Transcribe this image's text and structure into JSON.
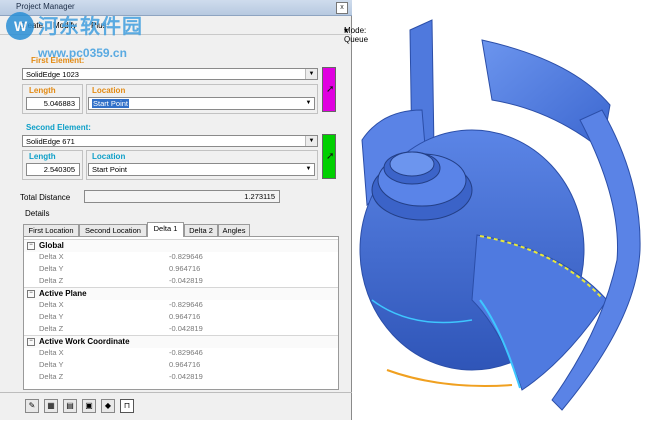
{
  "window": {
    "title": "Project Manager",
    "close_glyph": "x"
  },
  "menu": {
    "items": [
      "Create",
      "Modify",
      "Plus"
    ],
    "mode_label": "Mode: Queue",
    "mode_arrow": "▾"
  },
  "first_element": {
    "label": "First Element:",
    "entity": "SolidEdge 1023",
    "length_label": "Length",
    "length_value": "5.046883",
    "location_label": "Location",
    "location_value": "Start Point",
    "picker_color": "#e000e0"
  },
  "second_element": {
    "label": "Second Element:",
    "entity": "SolidEdge 671",
    "length_label": "Length",
    "length_value": "2.540305",
    "location_label": "Location",
    "location_value": "Start Point",
    "picker_color": "#00d000"
  },
  "total": {
    "label": "Total Distance",
    "value": "1.273115"
  },
  "details": {
    "label": "Details",
    "tabs": [
      "First Location",
      "Second Location",
      "Delta 1",
      "Delta 2",
      "Angles"
    ],
    "active_tab": "Delta 1",
    "sections": [
      {
        "title": "Global",
        "toggle": "−",
        "rows": [
          {
            "name": "Delta X",
            "value": "-0.829646"
          },
          {
            "name": "Delta Y",
            "value": "0.964716"
          },
          {
            "name": "Delta Z",
            "value": "-0.042819"
          }
        ]
      },
      {
        "title": "Active Plane",
        "toggle": "−",
        "rows": [
          {
            "name": "Delta X",
            "value": "-0.829646"
          },
          {
            "name": "Delta Y",
            "value": "0.964716"
          },
          {
            "name": "Delta Z",
            "value": "-0.042819"
          }
        ]
      },
      {
        "title": "Active Work Coordinate",
        "toggle": "−",
        "rows": [
          {
            "name": "Delta X",
            "value": "-0.829646"
          },
          {
            "name": "Delta Y",
            "value": "0.964716"
          },
          {
            "name": "Delta Z",
            "value": "-0.042819"
          }
        ]
      }
    ]
  },
  "bottom_toolbar": {
    "icons": [
      "measure-icon",
      "table-icon",
      "document-icon",
      "image-icon",
      "palette-icon",
      "ruler-icon"
    ],
    "glyphs": [
      "✎",
      "▦",
      "▤",
      "▣",
      "◆",
      "⊓"
    ]
  },
  "watermark": {
    "logo_glyph": "W",
    "line1": "河东软件园",
    "line2": "www.pc0359.cn"
  },
  "colors": {
    "model_blue": "#3f72dc",
    "highlight_cyan": "#3ec6ff",
    "highlight_orange": "#f0a020",
    "highlight_yellow": "#e8e83a"
  }
}
